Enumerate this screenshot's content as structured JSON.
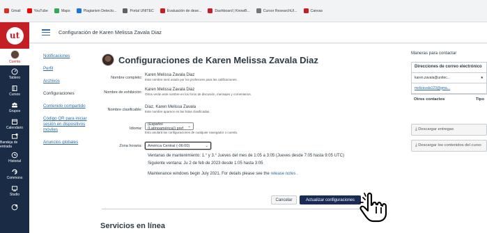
{
  "bookmarks": [
    {
      "label": "Gmail",
      "color": "#d93025"
    },
    {
      "label": "YouTube",
      "color": "#ff0000"
    },
    {
      "label": "Maps",
      "color": "#34a853"
    },
    {
      "label": "Plagiarism Detecto...",
      "color": "#1a73e8"
    },
    {
      "label": "Portal UNITEC",
      "color": "#5f6368"
    },
    {
      "label": "Evaluación de dese...",
      "color": "#c41f24"
    },
    {
      "label": "Dashboard | KnowB...",
      "color": "#c41f24"
    },
    {
      "label": "Cursor ResearchUI...",
      "color": "#777777"
    },
    {
      "label": "Canvas",
      "color": "#c41f24"
    }
  ],
  "gnav": {
    "logo": "ut",
    "items": [
      "Cuenta",
      "Tablero",
      "Cursos",
      "Grupos",
      "Calendario",
      "Bandeja de entrada",
      "Historial",
      "Commons",
      "Studio",
      ""
    ]
  },
  "header": {
    "breadcrumb": "Configuración de Karen Melissa Zavala Diaz"
  },
  "course_nav": [
    "Notificaciones",
    "Perfil",
    "Archivos",
    "Configuraciones",
    "Contenido compartido",
    "Código QR para iniciar sesión en dispositivos móviles",
    "Anuncios globales"
  ],
  "page_title": "Configuraciones de Karen Melissa Zavala Diaz",
  "form": {
    "full_name": {
      "label": "Nombre completo:",
      "value": "Karen Melissa Zavala Diaz",
      "hint": "Este nombre será usado por los profesores para las calificaciones."
    },
    "display_name": {
      "label": "Nombre de exhibición:",
      "value": "Karen Melissa Zavala Diaz",
      "hint": "Otros verán este nombre en los foros de discusión, mensajes y comentarios."
    },
    "sortable_name": {
      "label": "Nombre clasificable:",
      "value": "Diaz, Karen Melissa Zavala",
      "hint": "Este nombre aparece en las listas clasificadas."
    },
    "language": {
      "label": "Idioma:",
      "value": "(Español (Latinoamérica)) pref",
      "hint": "Esto anulará las configuraciones de cualquier navegador o cuenta."
    },
    "timezone": {
      "label": "Zona horaria:",
      "value": "América Central (-06:00)"
    }
  },
  "maintenance": {
    "line1": "Ventanas de mantenimiento: 1.° y 3.° Jueves del mes de 1:05 a 3:05 (Jueves desde 7:05 hasta 9:05 UTC)",
    "line2": "Siguiente ventana: Ju 2 de feb de 2023 desde 1:05 hasta 3:05",
    "line3_prefix": "Maintenance windows begin July 2021. For details please see the ",
    "line3_link": "release notes",
    "line3_suffix": " ."
  },
  "buttons": {
    "cancel": "Cancelar",
    "update": "Actualizar configuraciones"
  },
  "section_title": "Servicios en línea",
  "sidebar": {
    "title": "Maneras para contactar",
    "email_header": "Direcciones de correo electrónico",
    "email_primary": "karen.zavala@unitec...",
    "email_secondary": "melizavala123@gma...",
    "other_contacts": "Otros contactos",
    "type": "Tipo",
    "download_submissions": "Descargar entregas",
    "download_content": "Descargar los contenidos del curso"
  },
  "colors": {
    "brand": "#c41f24",
    "nav_bg": "#1a2b45",
    "link": "#2d6ca2",
    "primary_button": "#1b2b57"
  }
}
